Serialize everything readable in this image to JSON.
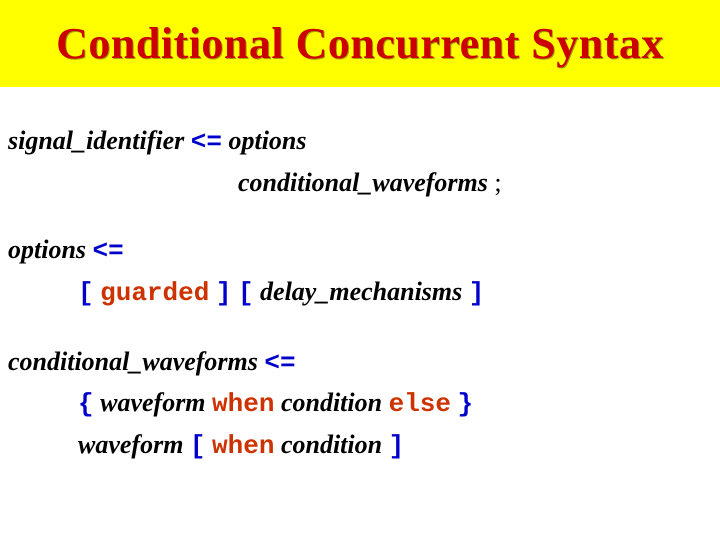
{
  "title": "Conditional Concurrent Syntax",
  "r1": {
    "lhs": "signal_identifier",
    "op": "<=",
    "t1": "options",
    "t2": "conditional_waveforms",
    "semi": ";"
  },
  "r2": {
    "lhs": "options",
    "op": "<=",
    "lb1": "[",
    "kw1": "guarded",
    "rb1": "]",
    "lb2": "[",
    "t1": "delay_mechanisms",
    "rb2": "]"
  },
  "r3": {
    "lhs": "conditional_waveforms",
    "op": "<=",
    "lbrace": "{",
    "t1": "waveform",
    "kw_when1": "when",
    "t2": "condition",
    "kw_else": "else",
    "rbrace": "}",
    "t3": "waveform",
    "lb": "[",
    "kw_when2": "when",
    "t4": "condition",
    "rb": "]"
  }
}
